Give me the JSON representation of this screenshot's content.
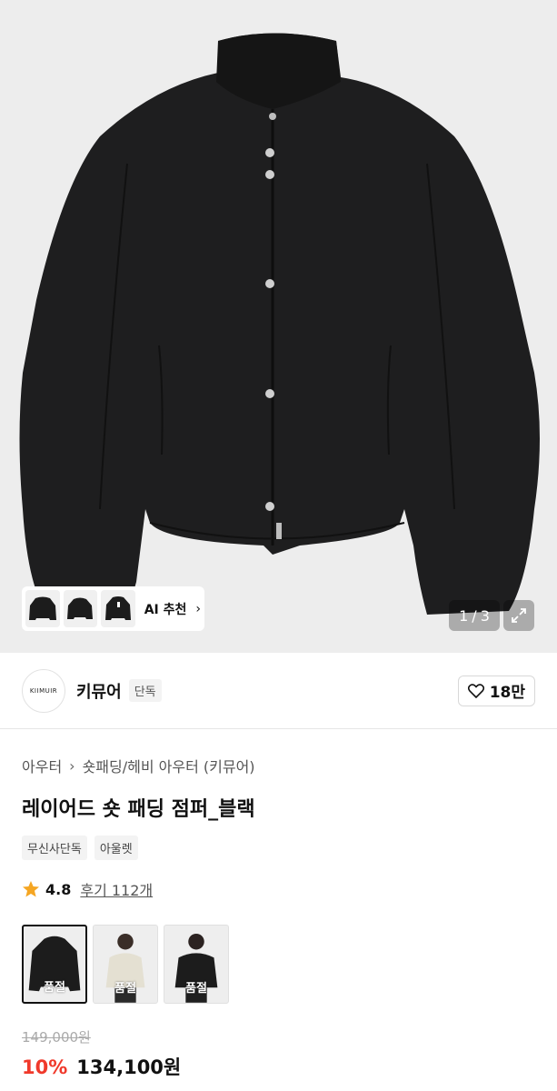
{
  "gallery": {
    "ai_label": "AI 추천",
    "page_current": "1",
    "page_sep": "/",
    "page_total": "3"
  },
  "brand": {
    "logo_text": "KIIMUIR",
    "name": "키뮤어",
    "badge": "단독",
    "likes": "18만"
  },
  "breadcrumb": [
    "아우터",
    "숏패딩/헤비 아우터 (키뮤어)"
  ],
  "product": {
    "title": "레이어드 숏 패딩 점퍼_블랙",
    "tags": [
      "무신사단독",
      "아울렛"
    ],
    "rating": "4.8",
    "reviews": "후기 112개"
  },
  "swatches": [
    {
      "label": "품절",
      "color": "#1c1c1c",
      "selected": true
    },
    {
      "label": "품절",
      "color": "#e7e3d6",
      "selected": false
    },
    {
      "label": "품절",
      "color": "#1c1c1c",
      "selected": false
    }
  ],
  "price": {
    "original": "149,000원",
    "discount": "10%",
    "sale": "134,100원"
  },
  "colors": {
    "accent_red": "#f0392b",
    "star": "#f5a623",
    "jacket": "#1c1c1c"
  }
}
